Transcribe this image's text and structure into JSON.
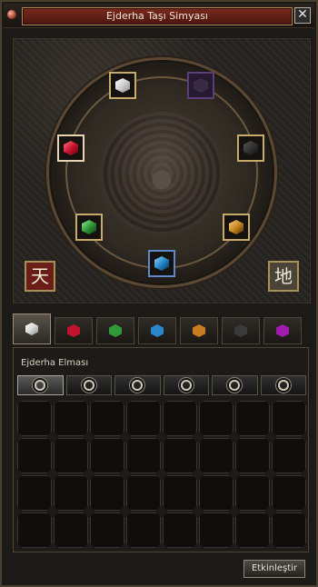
{
  "window": {
    "title": "Ejderha Taşı Simyası",
    "close_label": "✕"
  },
  "dial": {
    "heaven_char": "天",
    "earth_char": "地",
    "slots": [
      {
        "name": "diamond-slot",
        "gem": "white"
      },
      {
        "name": "onyx-slot",
        "gem": "dark"
      },
      {
        "name": "black-slot",
        "gem": "black"
      },
      {
        "name": "ruby-slot",
        "gem": "red"
      },
      {
        "name": "jade-slot",
        "gem": "green"
      },
      {
        "name": "sapphire-slot",
        "gem": "blue"
      },
      {
        "name": "garnet-slot",
        "gem": "yellow"
      }
    ]
  },
  "tabs": [
    {
      "name": "tab-diamond",
      "color": "#e9e9e9",
      "active": true
    },
    {
      "name": "tab-ruby",
      "color": "#c3142f"
    },
    {
      "name": "tab-jade",
      "color": "#2f9a3a"
    },
    {
      "name": "tab-sapphire",
      "color": "#2a86c8"
    },
    {
      "name": "tab-garnet",
      "color": "#c77d1f"
    },
    {
      "name": "tab-onyx",
      "color": "#3a3a3a"
    },
    {
      "name": "tab-amethyst",
      "color": "#a21bb0"
    }
  ],
  "panel": {
    "label": "Ejderha Elması",
    "filters": 6
  },
  "actions": {
    "activate_label": "Etkinleştir"
  }
}
